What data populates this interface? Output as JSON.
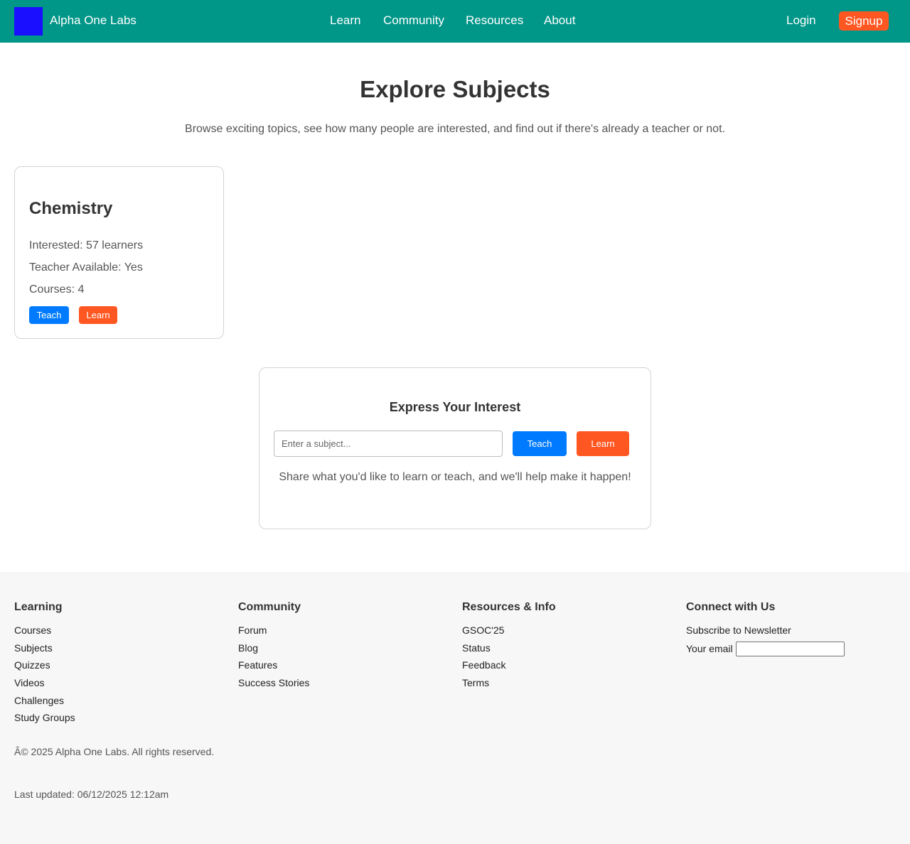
{
  "header": {
    "brand": "Alpha One Labs",
    "nav": [
      "Learn",
      "Community",
      "Resources",
      "About"
    ],
    "login": "Login",
    "signup": "Signup"
  },
  "hero": {
    "title": "Explore Subjects",
    "subtitle": "Browse exciting topics, see how many people are interested, and find out if there's already a teacher or not."
  },
  "subjects": [
    {
      "name": "Chemistry",
      "interested": "Interested: 57 learners",
      "teacher": "Teacher Available: Yes",
      "courses": "Courses: 4",
      "teach_label": "Teach",
      "learn_label": "Learn"
    }
  ],
  "interest": {
    "title": "Express Your Interest",
    "placeholder": "Enter a subject...",
    "teach_label": "Teach",
    "learn_label": "Learn",
    "note": "Share what you'd like to learn or teach, and we'll help make it happen!"
  },
  "footer": {
    "learning": {
      "heading": "Learning",
      "links": [
        "Courses",
        "Subjects",
        "Quizzes",
        "Videos",
        "Challenges",
        "Study Groups"
      ]
    },
    "community": {
      "heading": "Community",
      "links": [
        "Forum",
        "Blog",
        "Features",
        "Success Stories"
      ]
    },
    "resources": {
      "heading": "Resources & Info",
      "links": [
        "GSOC'25",
        "Status",
        "Feedback",
        "Terms"
      ]
    },
    "connect": {
      "heading": "Connect with Us",
      "newsletter": "Subscribe to Newsletter",
      "email_label": "Your email"
    },
    "copyright": "Â© 2025 Alpha One Labs. All rights reserved.",
    "updated": "Last updated: 06/12/2025 12:12am"
  },
  "colors": {
    "header_bg": "#009688",
    "logo": "#1a10ff",
    "accent_orange": "#ff5722",
    "accent_blue": "#007bff",
    "footer_bg": "#f7f7f7"
  }
}
